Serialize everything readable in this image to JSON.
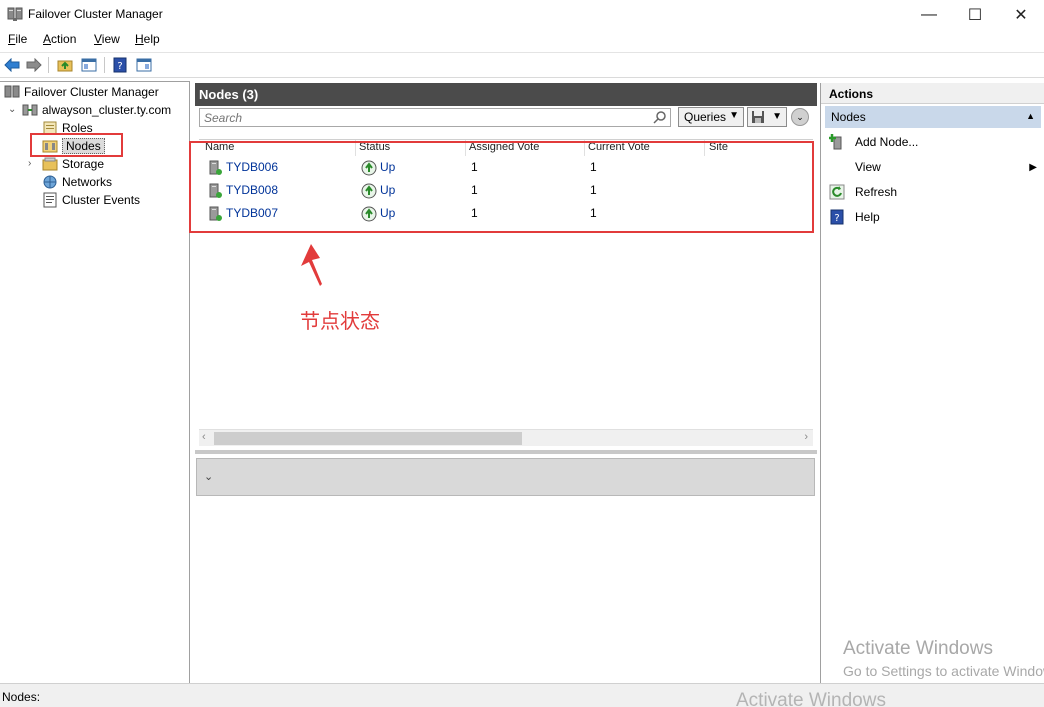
{
  "window": {
    "title": "Failover Cluster Manager",
    "minimize": "—",
    "maximize": "☐",
    "close": "✕"
  },
  "menu": {
    "items": [
      {
        "label": "File",
        "key": "F",
        "rest": "ile"
      },
      {
        "label": "Action",
        "key": "A",
        "rest": "ction"
      },
      {
        "label": "View",
        "key": "V",
        "rest": "iew"
      },
      {
        "label": "Help",
        "key": "H",
        "rest": "elp"
      }
    ]
  },
  "tree": {
    "root": "Failover Cluster Manager",
    "cluster": "alwayson_cluster.ty.com",
    "items": [
      {
        "label": "Roles"
      },
      {
        "label": "Nodes"
      },
      {
        "label": "Storage"
      },
      {
        "label": "Networks"
      },
      {
        "label": "Cluster Events"
      }
    ]
  },
  "center": {
    "header": "Nodes (3)",
    "search_placeholder": "Search",
    "queries_label": "Queries",
    "columns": [
      "Name",
      "Status",
      "Assigned Vote",
      "Current Vote",
      "Site"
    ],
    "rows": [
      {
        "name": "TYDB006",
        "status": "Up",
        "assigned_vote": "1",
        "current_vote": "1",
        "site": ""
      },
      {
        "name": "TYDB008",
        "status": "Up",
        "assigned_vote": "1",
        "current_vote": "1",
        "site": ""
      },
      {
        "name": "TYDB007",
        "status": "Up",
        "assigned_vote": "1",
        "current_vote": "1",
        "site": ""
      }
    ]
  },
  "annotation": {
    "text": "节点状态",
    "color": "#e23b3b"
  },
  "actions": {
    "header": "Actions",
    "section": "Nodes",
    "items": [
      {
        "label": "Add Node...",
        "icon": "add-node-icon"
      },
      {
        "label": "View",
        "icon": "none"
      },
      {
        "label": "Refresh",
        "icon": "refresh-icon"
      },
      {
        "label": "Help",
        "icon": "help-icon"
      }
    ]
  },
  "watermark": {
    "line1": "Activate Windows",
    "line2": "Go to Settings to activate Windows.",
    "line3": "Activate Windows"
  },
  "statusbar": {
    "text": "Nodes:"
  }
}
